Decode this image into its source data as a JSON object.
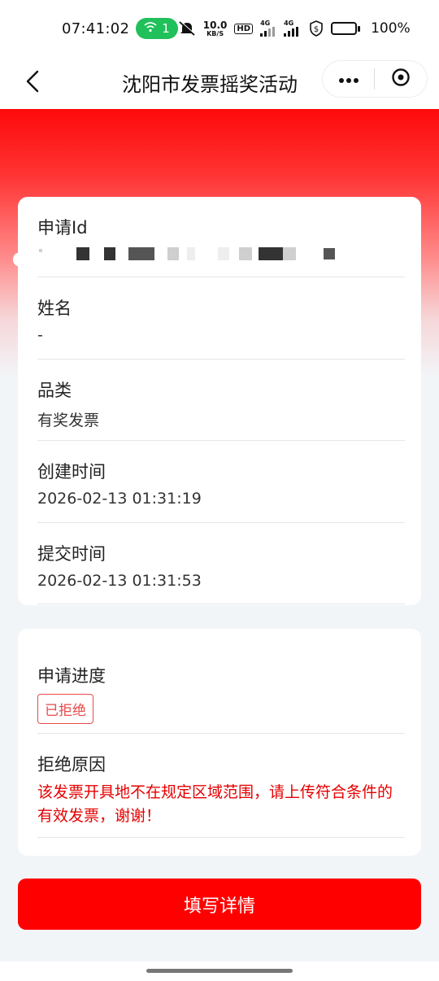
{
  "status_bar": {
    "time": "07:41:02",
    "hotspot_count": "1",
    "net_speed_value": "10.0",
    "net_speed_unit": "KB/S",
    "hd_label": "HD",
    "signal1_label": "4G",
    "signal2_label": "4G",
    "battery_percent": "100%",
    "battery_level": 1.0
  },
  "nav": {
    "title": "沈阳市发票摇奖活动",
    "back_icon": "chevron-left-icon",
    "more_icon": "more-dots-icon",
    "close_icon": "close-circle-icon"
  },
  "details": {
    "application_id": {
      "label": "申请Id",
      "value_masked": true
    },
    "name": {
      "label": "姓名",
      "value": "-"
    },
    "category": {
      "label": "品类",
      "value": "有奖发票"
    },
    "created": {
      "label": "创建时间",
      "value": "2026-02-13 01:31:19"
    },
    "submitted": {
      "label": "提交时间",
      "value": "2026-02-13 01:31:53"
    }
  },
  "progress": {
    "label": "申请进度",
    "status": "已拒绝",
    "status_color": "#e84a4a"
  },
  "rejection": {
    "label": "拒绝原因",
    "reason": "该发票开具地不在规定区域范围，请上传符合条件的有效发票，谢谢！",
    "reason_color": "#e60000"
  },
  "action": {
    "fill_details_label": "填写详情",
    "color": "#ff0000"
  },
  "theme": {
    "accent": "#fe0a0a"
  }
}
